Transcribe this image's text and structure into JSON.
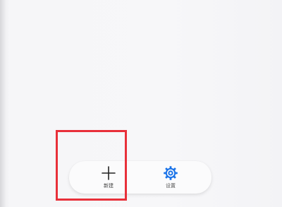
{
  "colors": {
    "background": "#f6f6f8",
    "bar_background": "#fbfbfc",
    "new_icon": "#222222",
    "settings_icon": "#1a73e8",
    "highlight": "#e8303a"
  },
  "bottom_bar": {
    "new_label": "新建",
    "new_icon": "plus-icon",
    "settings_label": "设置",
    "settings_icon": "gear-icon"
  }
}
